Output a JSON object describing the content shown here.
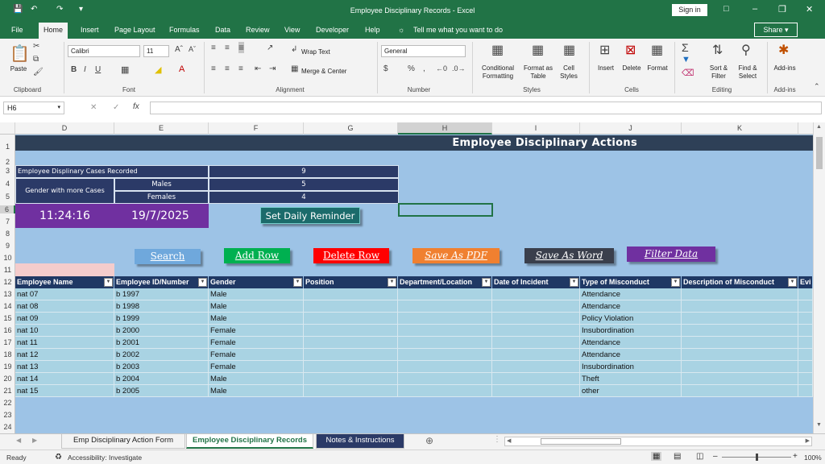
{
  "window": {
    "title": "Employee Disciplinary Records  -  Excel",
    "signin": "Sign in"
  },
  "menu": [
    "File",
    "Home",
    "Insert",
    "Page Layout",
    "Formulas",
    "Data",
    "Review",
    "View",
    "Developer",
    "Help"
  ],
  "tellme": "Tell me what you want to do",
  "share": "Share",
  "ribbon": {
    "paste": "Paste",
    "clipboard": "Clipboard",
    "font_name": "Calibri",
    "font_size": "11",
    "font": "Font",
    "wrap_text": "Wrap Text",
    "merge_center": "Merge & Center",
    "alignment": "Alignment",
    "number_format": "General",
    "number": "Number",
    "conditional": "Conditional",
    "formatting": "Formatting",
    "format_as": "Format as",
    "table": "Table",
    "cell": "Cell",
    "styles_btn": "Styles",
    "styles": "Styles",
    "insert": "Insert",
    "delete": "Delete",
    "format": "Format",
    "cells": "Cells",
    "sort": "Sort &",
    "filter": "Filter",
    "find": "Find &",
    "select": "Select",
    "editing": "Editing",
    "addins_btn": "Add-ins",
    "addins": "Add-ins"
  },
  "namebox": "H6",
  "columns": [
    "D",
    "E",
    "F",
    "G",
    "H",
    "I",
    "J",
    "K"
  ],
  "rows": [
    "1",
    "2",
    "3",
    "4",
    "5",
    "6",
    "7",
    "8",
    "9",
    "10",
    "11",
    "12",
    "13",
    "14",
    "15",
    "16",
    "17",
    "18",
    "19",
    "20",
    "21",
    "22",
    "23",
    "24"
  ],
  "banner": "Employee Disciplinary Actions",
  "summary": {
    "cases_label": "Employee Displinary Cases Recorded",
    "cases_value": "9",
    "gender_label": "Gender with more Cases",
    "males_label": "Males",
    "males_value": "5",
    "females_label": "Females",
    "females_value": "4"
  },
  "clock": {
    "time": "11:24:16",
    "date": "19/7/2025"
  },
  "buttons": {
    "reminder": "Set Daily Reminder",
    "search": "Search",
    "add_row": "Add Row",
    "delete_row": "Delete Row",
    "save_pdf": "Save As PDF",
    "save_word": "Save As Word",
    "filter": "Filter Data"
  },
  "table": {
    "headers": [
      "Employee Name",
      "Employee ID/Number",
      "Gender",
      "Position",
      "Department/Location",
      "Date of Incident",
      "Type of Misconduct",
      "Description of Misconduct",
      "Evi"
    ],
    "rows": [
      [
        "nat 07",
        "b 1997",
        "Male",
        "Attendance"
      ],
      [
        "nat 08",
        "b 1998",
        "Male",
        "Attendance"
      ],
      [
        "nat 09",
        "b 1999",
        "Male",
        "Policy Violation"
      ],
      [
        "nat 10",
        "b 2000",
        "Female",
        "Insubordination"
      ],
      [
        "nat 11",
        "b 2001",
        "Female",
        "Attendance"
      ],
      [
        "nat 12",
        "b 2002",
        "Female",
        "Attendance"
      ],
      [
        "nat 13",
        "b 2003",
        "Female",
        "Insubordination"
      ],
      [
        "nat 14",
        "b 2004",
        "Male",
        "Theft"
      ],
      [
        "nat 15",
        "b 2005",
        "Male",
        "other"
      ]
    ]
  },
  "tabs": [
    "Emp Disciplinary Action Form",
    "Employee Disciplinary Records",
    "Notes & Instructions"
  ],
  "status": {
    "ready": "Ready",
    "accessibility": "Accessibility: Investigate",
    "zoom": "100%"
  },
  "colors": {
    "excel_green": "#217346",
    "banner": "#2e4057",
    "grid_bg": "#9dc3e6",
    "row_bg": "#a9d3e3",
    "header_bg": "#1f3864",
    "clock_bg": "#7030a0"
  }
}
